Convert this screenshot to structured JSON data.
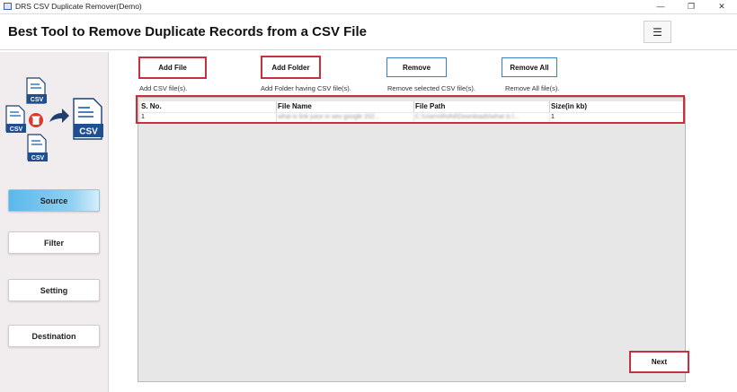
{
  "window": {
    "title": "DRS CSV Duplicate Remover(Demo)",
    "controls": {
      "minimize": "—",
      "maximize": "❐",
      "close": "✕"
    }
  },
  "header": {
    "heading": "Best Tool to Remove Duplicate Records from a CSV File",
    "menu_icon": "☰"
  },
  "logo": {
    "file_label": "CSV",
    "icons": [
      "csv-file-icon",
      "delete-icon",
      "arrow-icon"
    ]
  },
  "sidebar": {
    "items": [
      {
        "label": "Source",
        "active": true
      },
      {
        "label": "Filter",
        "active": false
      },
      {
        "label": "Setting",
        "active": false
      },
      {
        "label": "Destination",
        "active": false
      }
    ]
  },
  "toolbar": {
    "buttons": [
      {
        "label": "Add File",
        "description": "Add CSV file(s)."
      },
      {
        "label": "Add Folder",
        "description": "Add Folder having CSV file(s)."
      },
      {
        "label": "Remove",
        "description": "Remove selected CSV file(s)."
      },
      {
        "label": "Remove All",
        "description": "Remove All file(s)."
      }
    ]
  },
  "table": {
    "columns": [
      "S. No.",
      "File Name",
      "File Path",
      "Size(in kb)"
    ],
    "rows": [
      [
        "1",
        "what is link juice in seo google 202...",
        "C:\\Users\\Rohit\\Downloads\\what is l...",
        "1"
      ]
    ]
  },
  "footer": {
    "next_label": "Next"
  },
  "colors": {
    "highlight": "#c8303d",
    "active_nav": "#5bb8ea",
    "button_border": "#3a7fc4"
  }
}
